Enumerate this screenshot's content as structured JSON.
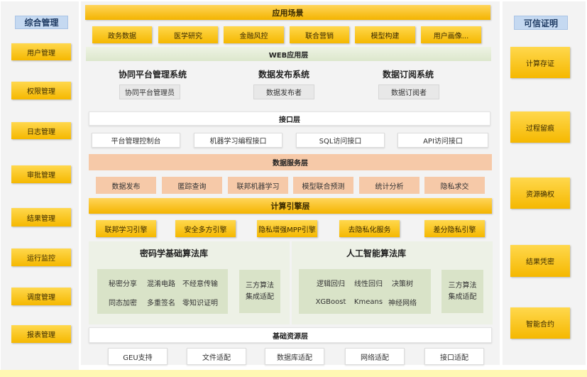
{
  "left_panel": {
    "title": "综合管理",
    "items": [
      "用户管理",
      "权限管理",
      "日志管理",
      "审批管理",
      "结果管理",
      "运行监控",
      "调度管理",
      "报表管理"
    ]
  },
  "right_panel": {
    "title": "可信证明",
    "items": [
      "计算存证",
      "过程留痕",
      "资源确权",
      "结果凭密",
      "智能合约"
    ]
  },
  "scenarios": {
    "title": "应用场景",
    "items": [
      "政务数据",
      "医学研究",
      "金融风控",
      "联合营销",
      "模型构建",
      "用户画像..."
    ]
  },
  "web_layer": {
    "title": "WEB应用层",
    "systems": [
      {
        "name": "协同平台管理系统",
        "role": "协同平台管理员"
      },
      {
        "name": "数据发布系统",
        "role": "数据发布者"
      },
      {
        "name": "数据订阅系统",
        "role": "数据订阅者"
      }
    ]
  },
  "interface_layer": {
    "title": "接口层",
    "items": [
      "平台管理控制台",
      "机器学习编程接口",
      "SQL访问接口",
      "API访问接口"
    ]
  },
  "data_service_layer": {
    "title": "数据服务层",
    "items": [
      "数据发布",
      "匿踪查询",
      "联邦机器学习",
      "模型联合预测",
      "统计分析",
      "隐私求交"
    ]
  },
  "compute_engine_layer": {
    "title": "计算引擎层",
    "items": [
      "联邦学习引擎",
      "安全多方引擎",
      "隐私增强MPP引擎",
      "去隐私化服务",
      "差分隐私引擎"
    ]
  },
  "crypto_library": {
    "title": "密码学基础算法库",
    "algorithms": [
      "秘密分享",
      "混淆电路",
      "不经意传输",
      "同态加密",
      "多重签名",
      "零知识证明"
    ],
    "adapter": "三方算法集成适配"
  },
  "ai_library": {
    "title": "人工智能算法库",
    "algorithms": [
      "逻辑回归",
      "线性回归",
      "决策树",
      "XGBoost",
      "Kmeans",
      "神经网络"
    ],
    "adapter": "三方算法集成适配"
  },
  "base_resource_layer": {
    "title": "基础资源层",
    "items": [
      "GEU支持",
      "文件适配",
      "数据库适配",
      "网络适配",
      "接口适配"
    ]
  },
  "colors": {
    "gold": "#f5b800",
    "side_header": "#c5d9f1",
    "green_panel": "#edf1e6",
    "green_box": "#d9e3c8",
    "salmon": "#f6c9a8",
    "grey_panel": "#f3f3f3"
  }
}
